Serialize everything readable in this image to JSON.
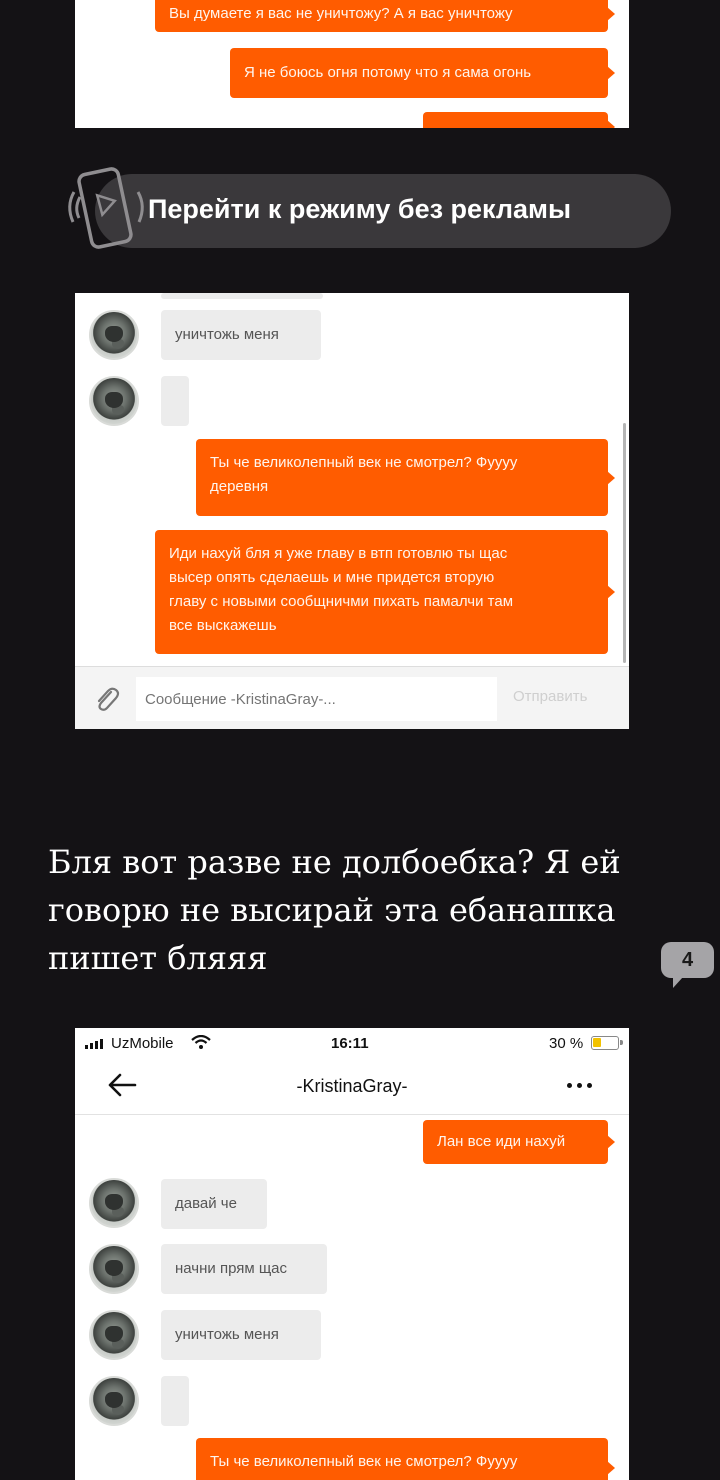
{
  "shot1": {
    "messages": [
      "Вы думаете я вас не уничтожу? А я вас уничтожу",
      "Я не боюсь огня потому что я сама огонь"
    ]
  },
  "promo": {
    "label": "Перейти к режиму без рекламы",
    "icon": "phone-vibrate-icon"
  },
  "shot2": {
    "messages": [
      {
        "side": "in",
        "text": "уничтожь меня"
      },
      {
        "side": "in",
        "text": ""
      },
      {
        "side": "out",
        "lines": [
          "Ты че великолепный век не смотрел? Фуууу",
          "деревня"
        ]
      },
      {
        "side": "out",
        "lines": [
          "Иди нахуй бля я уже главу в втп готовлю ты щас",
          "высер опять сделаешь и мне придется вторую",
          "главу с новыми сообщничми пихать памалчи там",
          "все выскажешь"
        ]
      }
    ],
    "input_placeholder": "Сообщение -KristinaGray-...",
    "send_label": "Отправить",
    "attach_icon": "paperclip-icon"
  },
  "caption": "Бля вот разве не долбоебка? Я ей говорю не высирай эта ебанашка пишет бляяя",
  "comment_count": "4",
  "shot3": {
    "status": {
      "carrier": "UzMobile",
      "time": "16:11",
      "battery": "30 %"
    },
    "header_title": "-KristinaGray-",
    "back_icon": "arrow-left-icon",
    "more_icon": "more-dots-icon",
    "messages": [
      {
        "side": "out",
        "text": "Лан все иди нахуй"
      },
      {
        "side": "in",
        "text": "давай че"
      },
      {
        "side": "in",
        "text": "начни прям щас"
      },
      {
        "side": "in",
        "text": "уничтожь меня"
      },
      {
        "side": "in",
        "text": ""
      },
      {
        "side": "out",
        "text": "Ты че великолепный век не смотрел? Фуууу"
      }
    ]
  },
  "colors": {
    "background": "#141215",
    "bubble_out": "#ff5c00",
    "bubble_in": "#ececec",
    "promo_pill": "#3a383b"
  }
}
